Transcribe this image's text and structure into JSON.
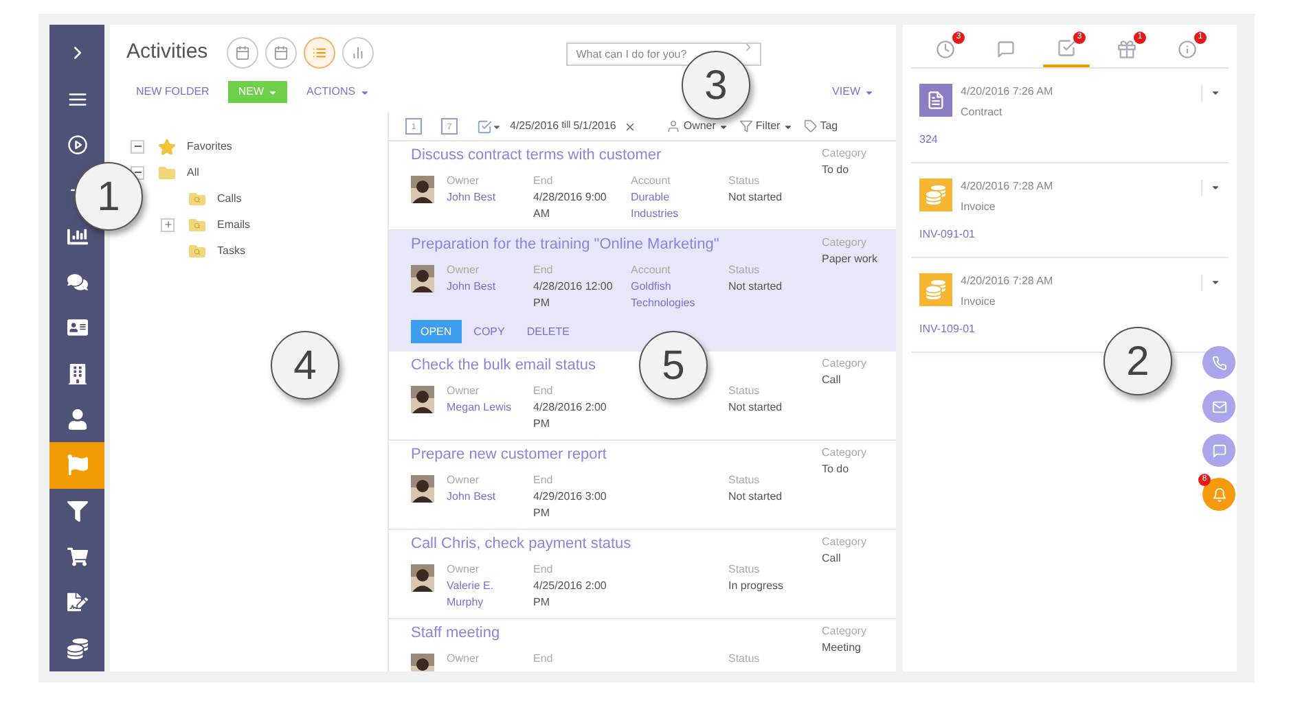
{
  "sidebar": {
    "items": [
      {
        "selected": false
      },
      {
        "selected": false
      },
      {
        "selected": false
      },
      {
        "selected": false
      },
      {
        "selected": false
      },
      {
        "selected": false
      },
      {
        "selected": false
      },
      {
        "selected": false
      },
      {
        "selected": false
      },
      {
        "selected": true
      },
      {
        "selected": false
      },
      {
        "selected": false
      },
      {
        "selected": false
      },
      {
        "selected": false
      }
    ]
  },
  "header": {
    "title": "Activities",
    "views": [
      {
        "selected": false
      },
      {
        "selected": false
      },
      {
        "selected": true
      },
      {
        "selected": false
      }
    ],
    "search": {
      "placeholder": "What can I do for you?"
    },
    "actions": [
      {
        "label": "NEW FOLDER",
        "kind": "link"
      },
      {
        "label": "NEW",
        "kind": "primary"
      },
      {
        "label": "ACTIONS",
        "kind": "menu"
      }
    ],
    "view_button": "VIEW"
  },
  "folders": [
    {
      "label": "Favorites",
      "kind": "star",
      "expanded": true
    },
    {
      "label": "All",
      "kind": "folder",
      "expanded": true,
      "children": [
        {
          "label": "Calls",
          "kind": "search-folder"
        },
        {
          "label": "Emails",
          "kind": "search-folder",
          "expanded": false
        },
        {
          "label": "Tasks",
          "kind": "search-folder"
        }
      ]
    }
  ],
  "filter_bar": {
    "periods": [
      "1",
      "7"
    ],
    "date_from": "4/25/2016",
    "till": "till",
    "date_to": "5/1/2016",
    "owner": "Owner",
    "filter": "Filter",
    "tag": "Tag"
  },
  "activities": [
    {
      "title": "Discuss contract terms with customer",
      "selected": false,
      "fields": [
        {
          "label": "Owner",
          "value": "John Best",
          "kind": "link"
        },
        {
          "label": "End",
          "value": "4/28/2016 9:00 AM",
          "kind": "text"
        },
        {
          "label": "Account",
          "value": "Durable Industries",
          "kind": "link"
        },
        {
          "label": "Status",
          "value": "Not started",
          "kind": "text"
        }
      ],
      "category": {
        "label": "Category",
        "value": "To do"
      }
    },
    {
      "title": "Preparation for the training \"Online Marketing\"",
      "selected": true,
      "fields": [
        {
          "label": "Owner",
          "value": "John Best",
          "kind": "link"
        },
        {
          "label": "End",
          "value": "4/28/2016 12:00 PM",
          "kind": "text"
        },
        {
          "label": "Account",
          "value": "Goldfish Technologies",
          "kind": "link"
        },
        {
          "label": "Status",
          "value": "Not started",
          "kind": "text"
        }
      ],
      "category": {
        "label": "Category",
        "value": "Paper work"
      }
    },
    {
      "title": "Check the bulk email status",
      "selected": false,
      "fields": [
        {
          "label": "Owner",
          "value": "Megan Lewis",
          "kind": "link"
        },
        {
          "label": "End",
          "value": "4/28/2016 2:00 PM",
          "kind": "text"
        },
        {
          "kind": "empty"
        },
        {
          "label": "Status",
          "value": "Not started",
          "kind": "text"
        }
      ],
      "category": {
        "label": "Category",
        "value": "Call"
      }
    },
    {
      "title": "Prepare new customer report",
      "selected": false,
      "fields": [
        {
          "label": "Owner",
          "value": "John Best",
          "kind": "link"
        },
        {
          "label": "End",
          "value": "4/29/2016 3:00 PM",
          "kind": "text"
        },
        {
          "kind": "empty"
        },
        {
          "label": "Status",
          "value": "Not started",
          "kind": "text"
        }
      ],
      "category": {
        "label": "Category",
        "value": "To do"
      }
    },
    {
      "title": "Call Chris, check payment status",
      "selected": false,
      "fields": [
        {
          "label": "Owner",
          "value": "Valerie E. Murphy",
          "kind": "link"
        },
        {
          "label": "End",
          "value": "4/25/2016 2:00 PM",
          "kind": "text"
        },
        {
          "kind": "empty"
        },
        {
          "label": "Status",
          "value": "In progress",
          "kind": "text"
        }
      ],
      "category": {
        "label": "Category",
        "value": "Call"
      }
    },
    {
      "title": "Staff meeting",
      "selected": false,
      "fields": [
        {
          "label": "Owner",
          "kind": "link"
        },
        {
          "label": "End",
          "kind": "text"
        },
        {
          "kind": "empty"
        },
        {
          "label": "Status",
          "kind": "text"
        }
      ],
      "category": {
        "label": "Category",
        "value": "Meeting"
      }
    }
  ],
  "row_actions": [
    "OPEN",
    "COPY",
    "DELETE"
  ],
  "right_panel": {
    "tabs": [
      {
        "badge": "3",
        "selected": false
      },
      {
        "selected": false
      },
      {
        "badge": "3",
        "selected": true
      },
      {
        "badge": "1",
        "selected": false
      },
      {
        "badge": "1",
        "selected": false
      }
    ],
    "feed": [
      {
        "kind": "contract",
        "date": "4/20/2016 7:26 AM",
        "type": "Contract",
        "link": "324"
      },
      {
        "kind": "invoice",
        "date": "4/20/2016 7:28 AM",
        "type": "Invoice",
        "link": "INV-091-01"
      },
      {
        "kind": "invoice",
        "date": "4/20/2016 7:28 AM",
        "type": "Invoice",
        "link": "INV-109-01"
      }
    ]
  },
  "notifications": {
    "badge": "8"
  },
  "callouts": [
    "1",
    "2",
    "3",
    "4",
    "5"
  ]
}
